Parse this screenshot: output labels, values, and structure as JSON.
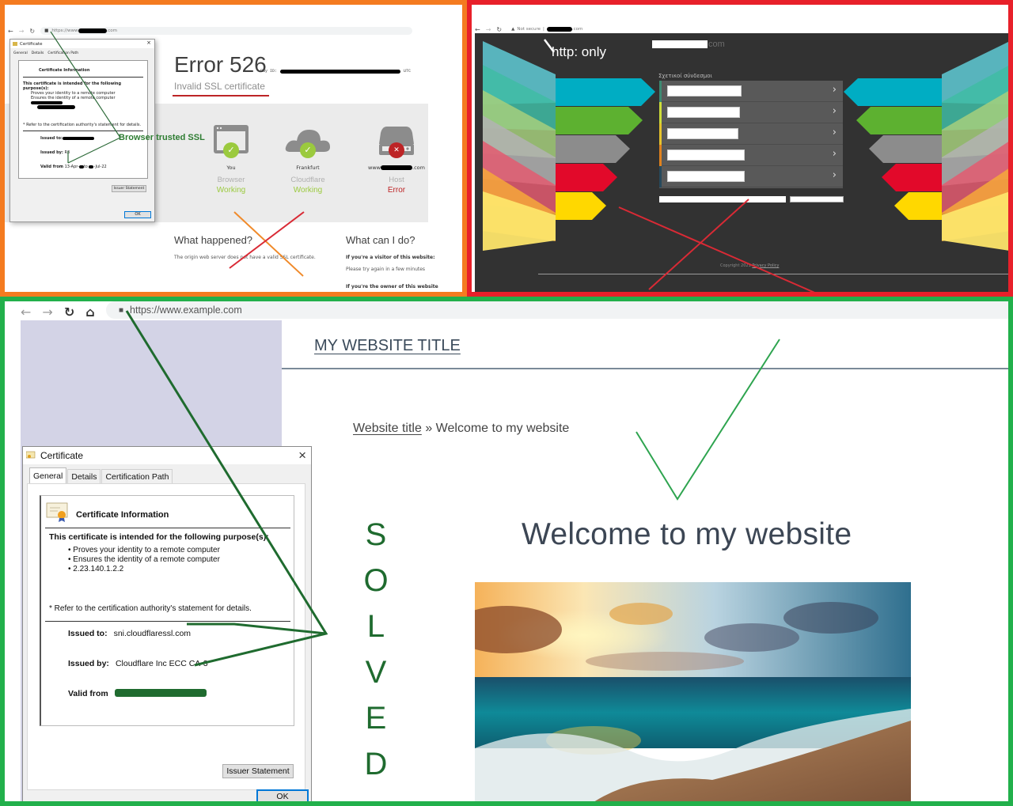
{
  "panels": {
    "error526": {
      "frame_color": "#f47b20",
      "browser": {
        "url_prefix": "https://www",
        "url_suffix": ".com"
      },
      "title": "Error 526",
      "ray_id_label": "Ray ID:",
      "ray_id_suffix": "UTC",
      "subtitle": "Invalid SSL certificate",
      "nodes": [
        {
          "location": "You",
          "name": "Browser",
          "status": "Working",
          "state": "ok",
          "icon": "browser-icon"
        },
        {
          "location": "Frankfurt",
          "name": "Cloudflare",
          "status": "Working",
          "state": "ok",
          "icon": "cloud-icon"
        },
        {
          "location_prefix": "www",
          "location_suffix": ".com",
          "name": "Host",
          "status": "Error",
          "state": "error",
          "icon": "server-icon"
        }
      ],
      "what_happened": {
        "heading": "What happened?",
        "text": "The origin web server does not have a valid SSL certificate."
      },
      "what_can_i_do": {
        "heading": "What can I do?",
        "visitor_heading": "If you're a visitor of this website:",
        "visitor_text": "Please try again in a few minutes",
        "owner_heading": "If you're the owner of this website"
      },
      "annotation": "Browser trusted SSL",
      "certificate": {
        "title": "Certificate",
        "tabs": [
          "General",
          "Details",
          "Certification Path"
        ],
        "info_title": "Certificate Information",
        "purpose_heading": "This certificate is intended for the following purpose(s):",
        "purposes": [
          "Proves your identity to a remote computer",
          "Ensures the identity of a remote computer"
        ],
        "refer_note": "* Refer to the certification authority's statement for details.",
        "issued_to_label": "Issued to:",
        "issued_by_label": "Issued by:",
        "issued_by_value": "R3",
        "valid_from_label": "Valid from",
        "valid_from_start": "13-Apr-",
        "valid_to_word": "to",
        "valid_to_end": "-Jul-22",
        "issuer_statement_label": "Issuer Statement",
        "ok_label": "OK"
      }
    },
    "http_only": {
      "frame_color": "#e8202a",
      "browser": {
        "security_label": "Not secure",
        "url_suffix": ".com"
      },
      "annotation": "http: only",
      "site_suffix": "com",
      "links_heading": "Σχετικοί σύνδεσμοι",
      "link_bar_colors": [
        "#3d8a72",
        "#cddc39",
        "#e6c32c",
        "#e0821e",
        "#27495c"
      ],
      "arrow_colors": [
        "#00adc3",
        "#5db130",
        "#8c8c8c",
        "#e2092a",
        "#ffd800"
      ],
      "copyright": "Copyright 2021",
      "privacy_link": "Privacy Policy"
    },
    "solved": {
      "frame_color": "#22b04b",
      "browser": {
        "url": "https://www.example.com"
      },
      "site_title": "MY WEBSITE TITLE",
      "breadcrumb": {
        "home": "Website title",
        "separator": "»",
        "current": "Welcome to my website"
      },
      "heading": "Welcome to my website",
      "annotation_letters": [
        "S",
        "O",
        "L",
        "V",
        "E",
        "D"
      ],
      "hero_image": "beach-sunset",
      "certificate": {
        "title": "Certificate",
        "tabs": [
          "General",
          "Details",
          "Certification Path"
        ],
        "active_tab": "General",
        "info_title": "Certificate Information",
        "purpose_heading": "This certificate is intended for the following purpose(s):",
        "purposes": [
          "Proves your identity to a remote computer",
          "Ensures the identity of a remote computer",
          "2.23.140.1.2.2"
        ],
        "refer_note": "* Refer to the certification authority's statement for details.",
        "issued_to_label": "Issued to:",
        "issued_to_value": "sni.cloudflaressl.com",
        "issued_by_label": "Issued by:",
        "issued_by_value": "Cloudflare Inc ECC CA-3",
        "valid_from_label": "Valid from",
        "issuer_statement_label": "Issuer Statement",
        "ok_label": "OK"
      }
    }
  }
}
